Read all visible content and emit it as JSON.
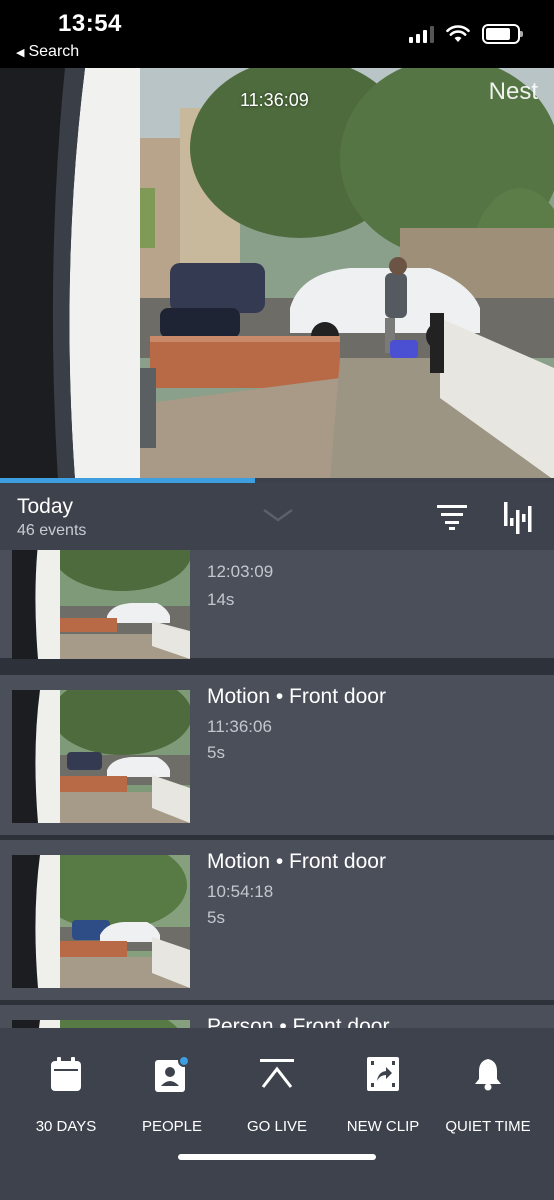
{
  "status": {
    "time": "13:54",
    "back_label": "Search"
  },
  "camera": {
    "timestamp": "11:36:09",
    "brand": "Nest",
    "playback_progress_percent": 46
  },
  "header": {
    "title": "Today",
    "subtitle": "46 events"
  },
  "events": [
    {
      "title": "",
      "time": "12:03:09",
      "duration": "14s"
    },
    {
      "title": "Motion • Front door",
      "time": "11:36:06",
      "duration": "5s"
    },
    {
      "title": "Motion • Front door",
      "time": "10:54:18",
      "duration": "5s"
    },
    {
      "title": "Person • Front door",
      "time": "",
      "duration": ""
    }
  ],
  "nav": [
    {
      "label": "30 DAYS",
      "icon": "calendar-icon"
    },
    {
      "label": "PEOPLE",
      "icon": "person-badge-icon"
    },
    {
      "label": "GO LIVE",
      "icon": "go-live-icon"
    },
    {
      "label": "NEW CLIP",
      "icon": "new-clip-icon"
    },
    {
      "label": "QUIET TIME",
      "icon": "bell-icon"
    }
  ],
  "colors": {
    "accent": "#3d9fe0",
    "panel": "#3d424c",
    "row": "#4a4f59",
    "notification_dot": "#3d9fe0"
  }
}
